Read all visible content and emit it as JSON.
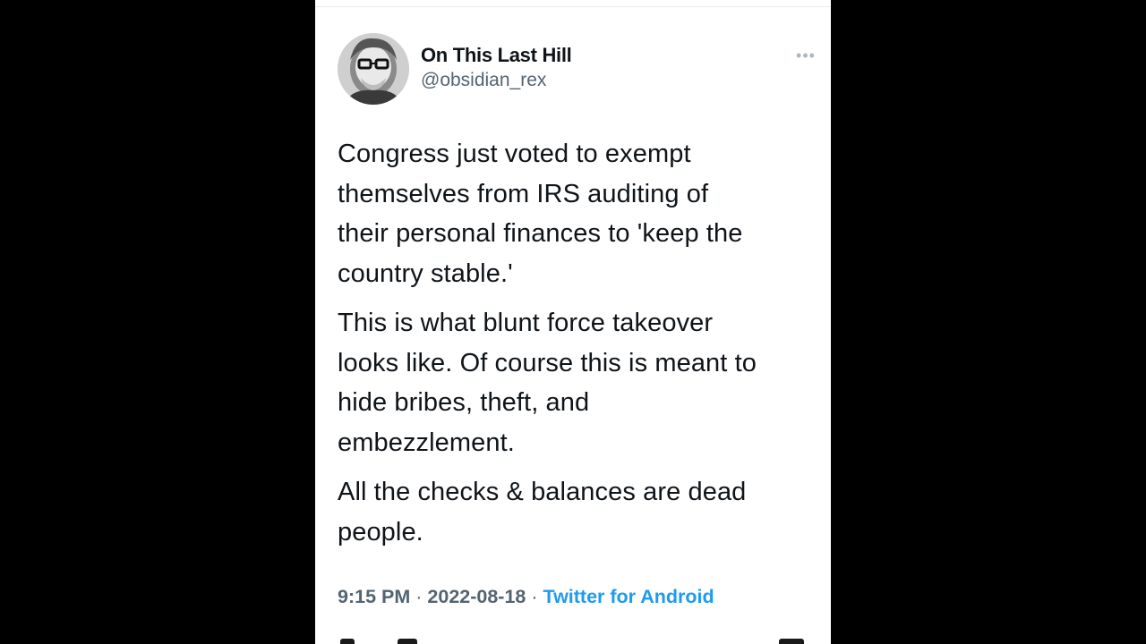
{
  "tweet": {
    "author": {
      "display_name": "On This Last Hill",
      "handle": "@obsidian_rex"
    },
    "more_icon": "more-dots-icon",
    "paragraphs": [
      "Congress just voted to exempt\nthemselves from IRS auditing of\ntheir personal finances to 'keep the\ncountry stable.'",
      "This is what blunt force takeover\nlooks like. Of course this is meant to\nhide bribes, theft, and\nembezzlement.",
      "All the checks & balances are dead\npeople."
    ],
    "meta": {
      "time": "9:15 PM",
      "separator": "·",
      "date": "2022-08-18",
      "source": "Twitter for Android"
    }
  },
  "colors": {
    "background": "#000000",
    "card": "#ffffff",
    "text": "#0f1419",
    "secondary": "#536471",
    "link": "#1d9bf0"
  }
}
